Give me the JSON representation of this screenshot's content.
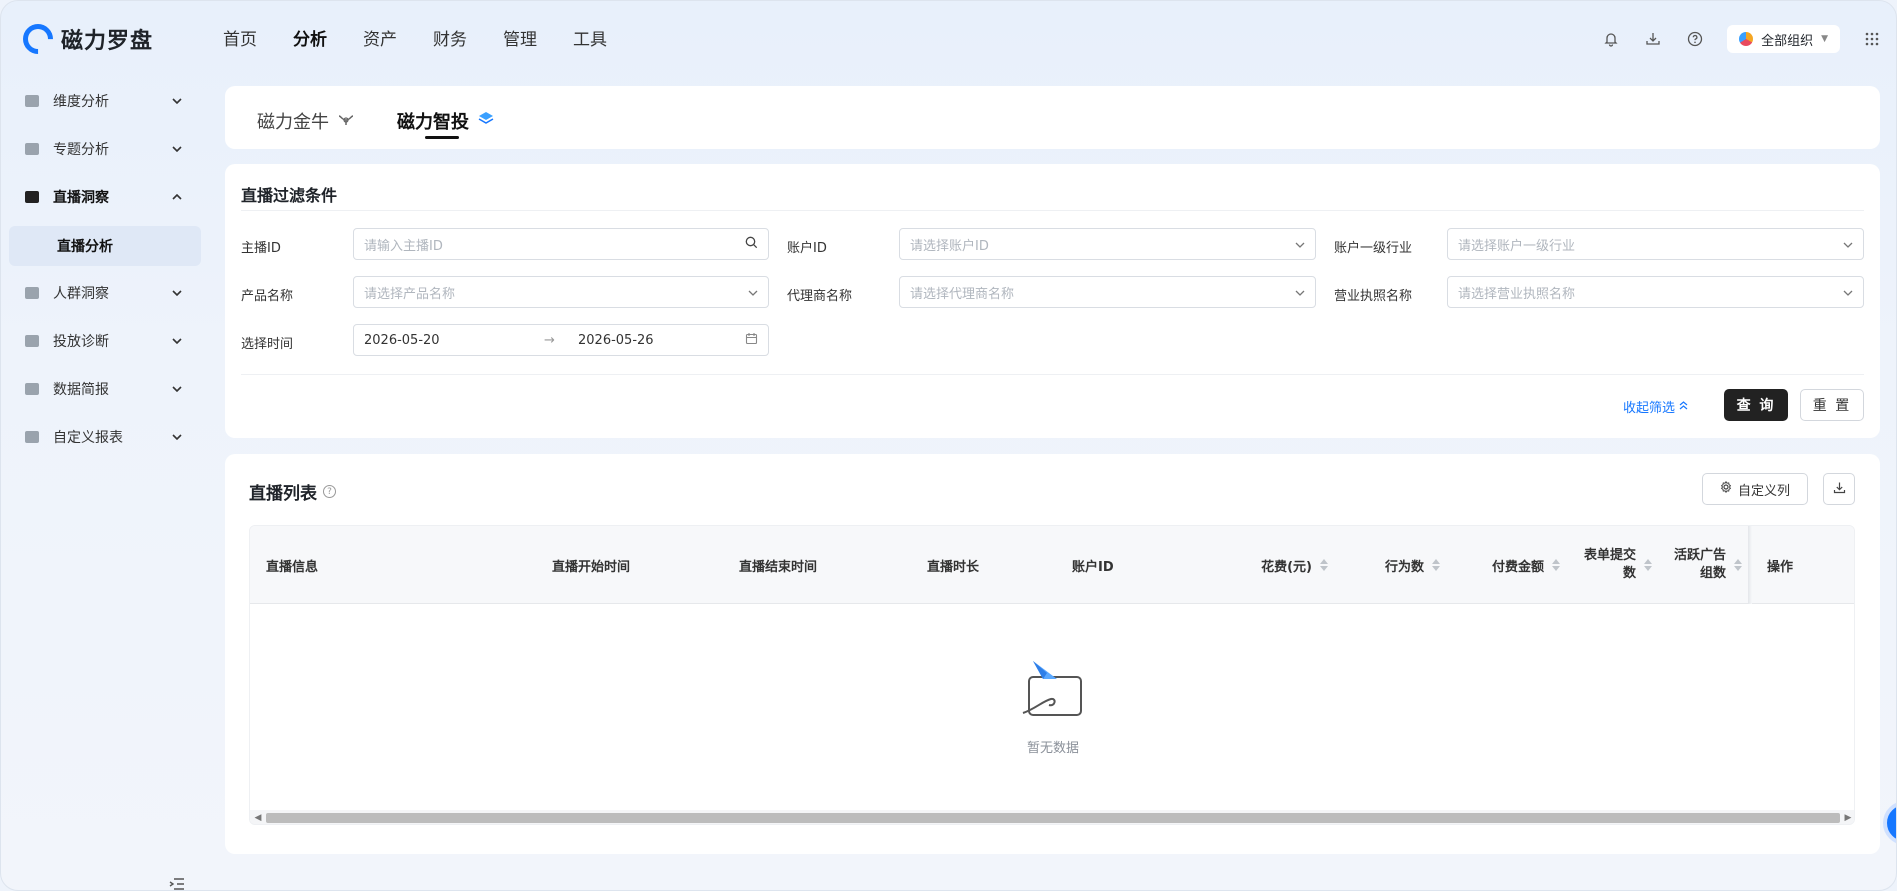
{
  "app": {
    "logo_text": "磁力罗盘",
    "org_label": "全部组织"
  },
  "topnav": [
    "首页",
    "分析",
    "资产",
    "财务",
    "管理",
    "工具"
  ],
  "sidebar": {
    "items": [
      {
        "label": "维度分析",
        "expanded": false
      },
      {
        "label": "专题分析",
        "expanded": false
      },
      {
        "label": "直播洞察",
        "expanded": true
      },
      {
        "label": "人群洞察",
        "expanded": false
      },
      {
        "label": "投放诊断",
        "expanded": false
      },
      {
        "label": "数据简报",
        "expanded": false
      },
      {
        "label": "自定义报表",
        "expanded": false
      }
    ],
    "sub_item": "直播分析"
  },
  "tabs": [
    {
      "label": "磁力金牛"
    },
    {
      "label": "磁力智投"
    }
  ],
  "filter": {
    "title": "直播过滤条件",
    "fields": [
      {
        "label": "主播ID",
        "placeholder": "请输入主播ID"
      },
      {
        "label": "账户ID",
        "placeholder": "请选择账户ID"
      },
      {
        "label": "账户一级行业",
        "placeholder": "请选择账户一级行业"
      },
      {
        "label": "产品名称",
        "placeholder": "请选择产品名称"
      },
      {
        "label": "代理商名称",
        "placeholder": "请选择代理商名称"
      },
      {
        "label": "营业执照名称",
        "placeholder": "请选择营业执照名称"
      }
    ],
    "time_label": "选择时间",
    "date_start": "2026-05-20",
    "date_end": "2026-05-26",
    "collapse_label": "收起筛选",
    "query_label": "查 询",
    "reset_label": "重 置"
  },
  "list": {
    "title": "直播列表",
    "custom_cols_label": "自定义列",
    "columns": [
      {
        "label": "直播信息"
      },
      {
        "label": "直播开始时间"
      },
      {
        "label": "直播结束时间"
      },
      {
        "label": "直播时长"
      },
      {
        "label": "账户ID"
      },
      {
        "label": "花费(元)"
      },
      {
        "label": "行为数"
      },
      {
        "label": "付费金额"
      },
      {
        "label": "表单提交数"
      },
      {
        "label": "活跃广告组数"
      },
      {
        "label": "操作"
      }
    ],
    "empty_text": "暂无数据"
  }
}
